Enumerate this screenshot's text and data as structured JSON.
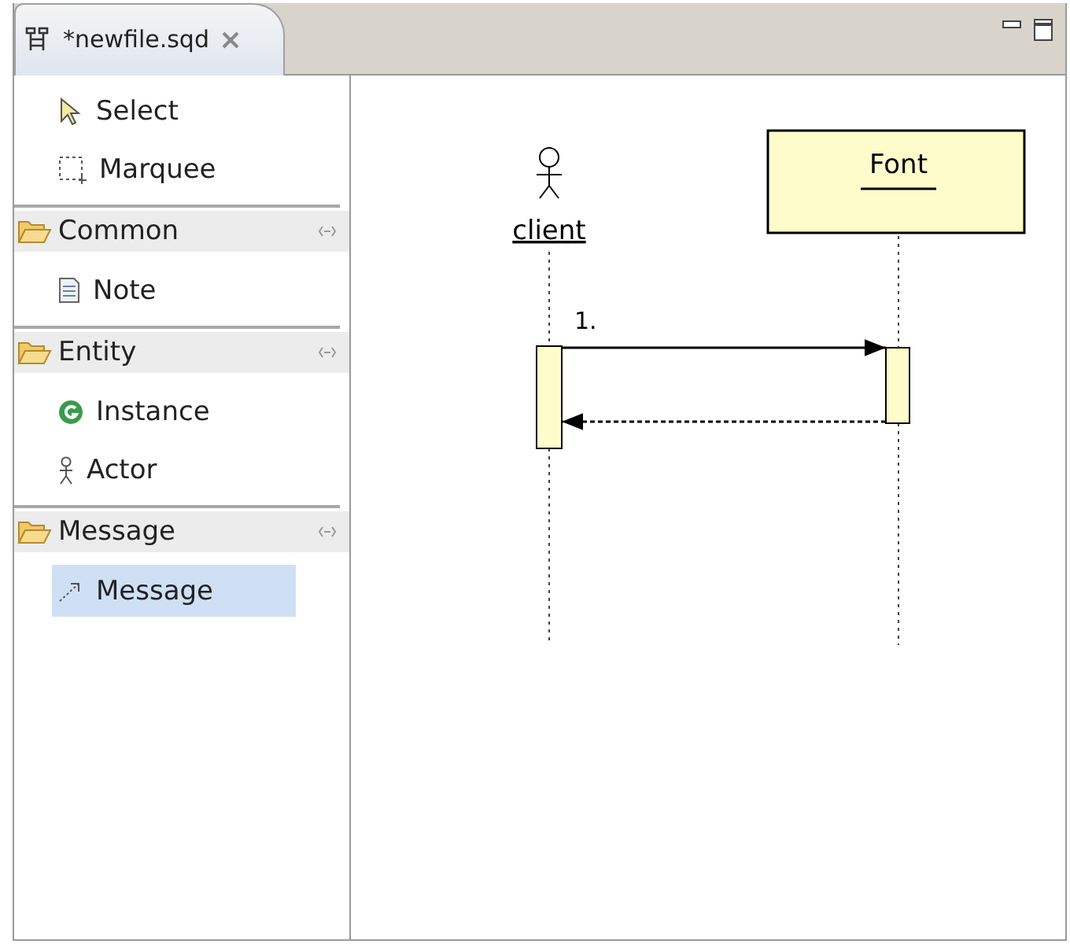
{
  "editor_tab": {
    "title": "*newfile.sqd",
    "selected": true
  },
  "palette": {
    "tools": [
      {
        "label": "Select",
        "kind": "select",
        "selected": false
      },
      {
        "label": "Marquee",
        "kind": "marquee",
        "selected": false
      }
    ],
    "drawers": [
      {
        "label": "Common",
        "expanded": true,
        "items": [
          {
            "label": "Note",
            "kind": "note",
            "selected": false
          }
        ]
      },
      {
        "label": "Entity",
        "expanded": true,
        "items": [
          {
            "label": "Instance",
            "kind": "instance",
            "selected": false
          },
          {
            "label": "Actor",
            "kind": "actor",
            "selected": false
          }
        ]
      },
      {
        "label": "Message",
        "expanded": true,
        "items": [
          {
            "label": "Message",
            "kind": "message",
            "selected": true
          }
        ]
      }
    ]
  },
  "diagram": {
    "actor": {
      "name": "client"
    },
    "object": {
      "name": "Font"
    },
    "messages": [
      {
        "kind": "call",
        "label": "1."
      },
      {
        "kind": "return"
      }
    ]
  }
}
